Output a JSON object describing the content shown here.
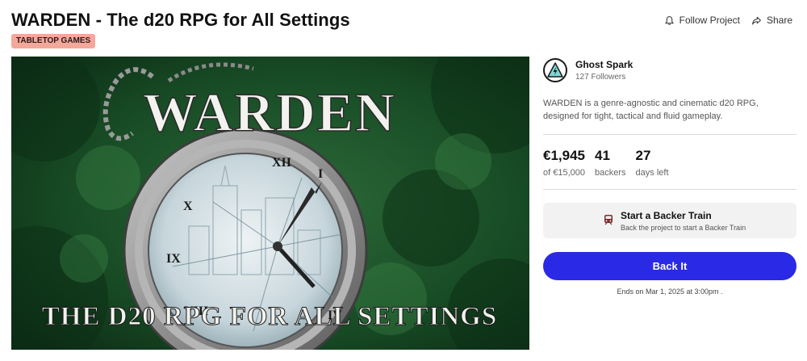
{
  "header": {
    "title": "WARDEN - The d20 RPG for All Settings",
    "category_tag": "TABLETOP GAMES",
    "follow_label": "Follow Project",
    "share_label": "Share"
  },
  "hero": {
    "image_title": "WARDEN",
    "image_subtitle": "THE D20 RPG FOR ALL SETTINGS",
    "colors": {
      "bg": "#143c1e",
      "title": "#f2f2ee"
    }
  },
  "creator": {
    "name": "Ghost Spark",
    "followers": "127 Followers",
    "avatar_icon": "lightning-warning-icon"
  },
  "description": "WARDEN is a genre-agnostic and cinematic d20 RPG, designed for tight, tactical and fluid gameplay.",
  "stats": [
    {
      "value": "€1,945",
      "label": "of €15,000"
    },
    {
      "value": "41",
      "label": "backers"
    },
    {
      "value": "27",
      "label": "days left"
    }
  ],
  "backer_train": {
    "title": "Start a Backer Train",
    "subtitle": "Back the project to start a Backer Train",
    "icon": "train-icon"
  },
  "back_button": {
    "label": "Back It",
    "color": "#2a2ae6"
  },
  "ends_text": "Ends on Mar 1, 2025 at 3:00pm ."
}
